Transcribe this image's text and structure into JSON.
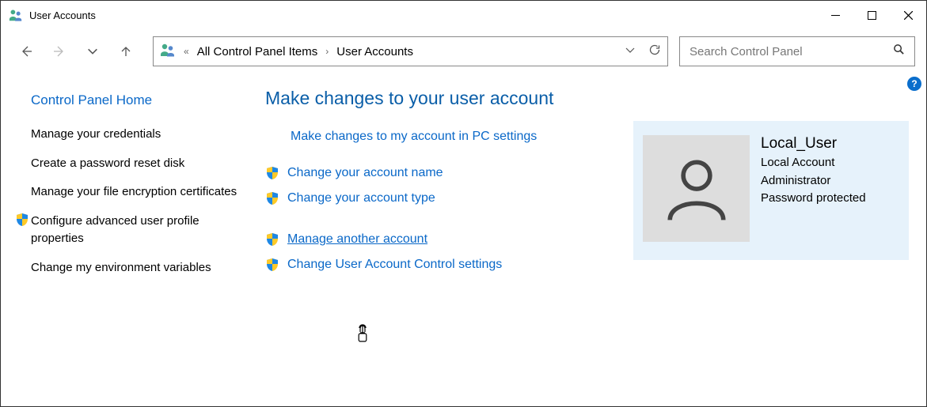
{
  "window": {
    "title": "User Accounts"
  },
  "breadcrumb": {
    "item1": "All Control Panel Items",
    "item2": "User Accounts"
  },
  "search": {
    "placeholder": "Search Control Panel"
  },
  "sidebar": {
    "home": "Control Panel Home",
    "items": [
      {
        "label": "Manage your credentials",
        "shield": false
      },
      {
        "label": "Create a password reset disk",
        "shield": false
      },
      {
        "label": "Manage your file encryption certificates",
        "shield": false
      },
      {
        "label": "Configure advanced user profile properties",
        "shield": true
      },
      {
        "label": "Change my environment variables",
        "shield": false
      }
    ]
  },
  "main": {
    "heading": "Make changes to your user account",
    "actions": {
      "pc_settings": "Make changes to my account in PC settings",
      "change_name": "Change your account name",
      "change_type": "Change your account type",
      "manage_another": "Manage another account",
      "uac_settings": "Change User Account Control settings"
    }
  },
  "user": {
    "name": "Local_User",
    "type": "Local Account",
    "role": "Administrator",
    "pw": "Password protected"
  },
  "help": "?"
}
